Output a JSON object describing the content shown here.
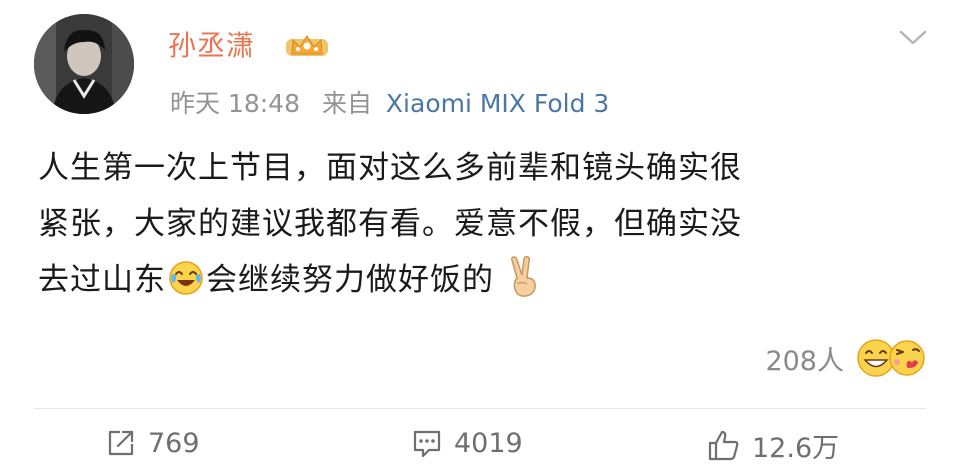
{
  "post": {
    "author": {
      "name": "孙丞潇"
    },
    "meta": {
      "time": "昨天 18:48",
      "source_prefix": "来自",
      "device": "Xiaomi MIX Fold 3"
    },
    "content_lines": [
      "人生第一次上节目，面对这么多前辈和镜头确实很",
      "紧张，大家的建议我都有看。爱意不假，但确实没",
      "去过山东"
    ],
    "content_tail": "会继续努力做好饭的",
    "reactions": {
      "count": "208人"
    }
  },
  "actions": {
    "repost": {
      "icon": "share-icon",
      "count": "769"
    },
    "comment": {
      "icon": "comment-icon",
      "count": "4019"
    },
    "like": {
      "icon": "thumbs-up-icon",
      "count": "12.6万"
    }
  },
  "colors": {
    "username": "#eb7350",
    "device_link": "#4a76a8",
    "text": "#1a1a1a",
    "muted": "#939393"
  }
}
